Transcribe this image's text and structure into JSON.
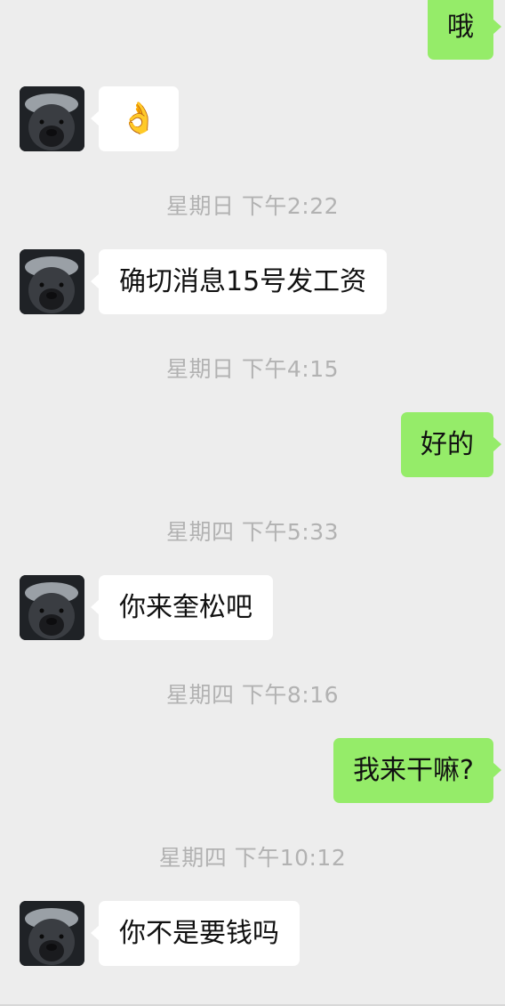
{
  "chat": {
    "messages": [
      {
        "side": "right",
        "text": "哦"
      },
      {
        "side": "left",
        "text": "👌"
      },
      {
        "side": "timestamp",
        "text": "星期日 下午2:22"
      },
      {
        "side": "left",
        "text": "确切消息15号发工资"
      },
      {
        "side": "timestamp",
        "text": "星期日 下午4:15"
      },
      {
        "side": "right",
        "text": "好的"
      },
      {
        "side": "timestamp",
        "text": "星期四 下午5:33"
      },
      {
        "side": "left",
        "text": "你来奎松吧"
      },
      {
        "side": "timestamp",
        "text": "星期四 下午8:16"
      },
      {
        "side": "right",
        "text": "我来干嘛?"
      },
      {
        "side": "timestamp",
        "text": "星期四 下午10:12"
      },
      {
        "side": "left",
        "text": "你不是要钱吗"
      }
    ]
  },
  "colors": {
    "background": "#ededed",
    "bubble_self": "#95ec69",
    "bubble_other": "#ffffff",
    "timestamp_text": "#b2b2b2"
  },
  "icons": {
    "avatar": "honey-badger-avatar"
  }
}
